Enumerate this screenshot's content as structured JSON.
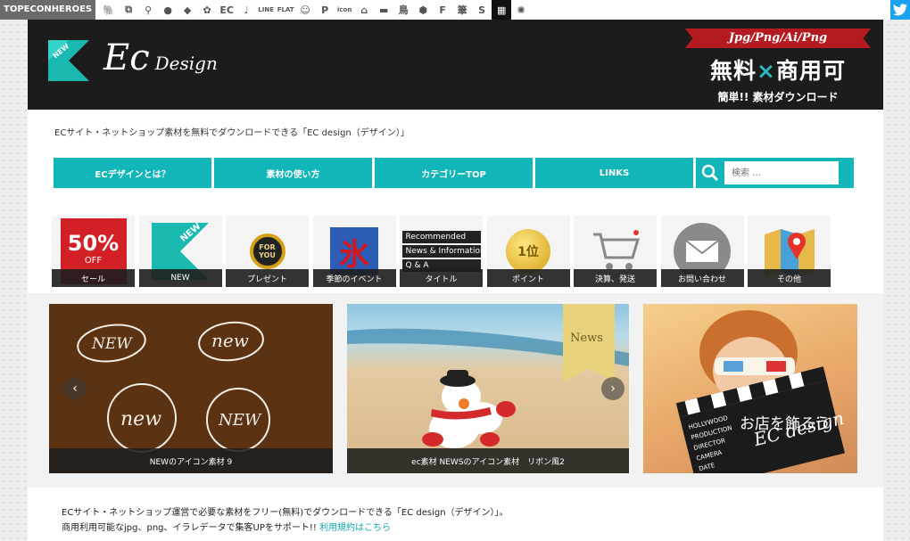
{
  "topbar": {
    "brand": "TOPECONHEROES",
    "icons": [
      {
        "name": "dog-icon",
        "glyph": "🐘"
      },
      {
        "name": "copy-icon",
        "glyph": "⧉"
      },
      {
        "name": "person-icon",
        "glyph": "⚲"
      },
      {
        "name": "speech-bubble-icon",
        "glyph": "●"
      },
      {
        "name": "tag-icon",
        "glyph": "◆"
      },
      {
        "name": "gear-icon",
        "glyph": "✿"
      },
      {
        "name": "ec-icon",
        "glyph": "EC"
      },
      {
        "name": "note-icon",
        "glyph": "♩"
      },
      {
        "name": "line-icon",
        "glyph": "LINE"
      },
      {
        "name": "flat-icon",
        "glyph": "FLAT"
      },
      {
        "name": "smiley-icon",
        "glyph": "☺"
      },
      {
        "name": "parking-icon",
        "glyph": "P"
      },
      {
        "name": "icon-icon",
        "glyph": "icon"
      },
      {
        "name": "house-icon",
        "glyph": "⌂"
      },
      {
        "name": "sofa-icon",
        "glyph": "▬"
      },
      {
        "name": "bird-icon",
        "glyph": "鳥"
      },
      {
        "name": "hexagon-icon",
        "glyph": "⬢"
      },
      {
        "name": "f-icon",
        "glyph": "F"
      },
      {
        "name": "brush-icon",
        "glyph": "筆"
      },
      {
        "name": "s-icon",
        "glyph": "S"
      },
      {
        "name": "grid-icon",
        "glyph": "▦"
      },
      {
        "name": "firework-icon",
        "glyph": "✺"
      }
    ]
  },
  "header": {
    "badge": "NEW",
    "logo_main": "Ec",
    "logo_sub": "Design",
    "promo_ribbon": "Jpg/Png/Ai/Png",
    "promo_main_1": "無料",
    "promo_x": "×",
    "promo_main_2": "商用可",
    "promo_sub": "簡単!! 素材ダウンロード"
  },
  "tagline": "ECサイト・ネットショップ素材を無料でダウンロードできる「EC design（デザイン）」",
  "nav": {
    "items": [
      "ECデザインとは？",
      "素材の使い方",
      "カテゴリーTOP",
      "LINKS"
    ],
    "search_placeholder": "検索 …"
  },
  "categories": [
    {
      "label": "セール",
      "thumb_text": "50%",
      "thumb_sub": "OFF",
      "color": "#d32027"
    },
    {
      "label": "NEW",
      "thumb_text": "NEW",
      "color": "#1ab9b0"
    },
    {
      "label": "プレゼント",
      "thumb_text": "FOR YOU",
      "color": "#a3202a"
    },
    {
      "label": "季節のイベント",
      "thumb_text": "氷",
      "color": "#1a4f9c"
    },
    {
      "label": "タイトル",
      "thumb_lines": [
        "Recommended",
        "News & Information",
        "Q & A"
      ],
      "color": "#222222"
    },
    {
      "label": "ポイント",
      "thumb_text": "1位",
      "color": "#d4a017"
    },
    {
      "label": "決算、発送",
      "thumb_text": "cart",
      "color": "#999999"
    },
    {
      "label": "お問い合わせ",
      "thumb_text": "mail",
      "color": "#888888"
    },
    {
      "label": "その他",
      "thumb_text": "map",
      "color": "#e63329"
    }
  ],
  "slides": [
    {
      "caption": "NEWのアイコン素材 9",
      "words": [
        "NEW",
        "new",
        "new",
        "NEW"
      ]
    },
    {
      "caption": "ec素材 NEWSのアイコン素材　リボン風2",
      "badge": "News"
    },
    {
      "caption": "",
      "overlay": "お店を飾ろう",
      "board_lines": [
        "HOLLYWOOD",
        "PRODUCTION",
        "DIRECTOR",
        "CAMERA",
        "DATE"
      ],
      "board_logo": "EC design"
    }
  ],
  "footer": {
    "line1": "ECサイト・ネットショップ運営で必要な素材をフリー(無料)でダウンロードできる「EC design（デザイン）」。",
    "line2": "商用利用可能なjpg、png、イラレデータで集客UPをサポート!!",
    "link": "利用規約はこちら"
  }
}
